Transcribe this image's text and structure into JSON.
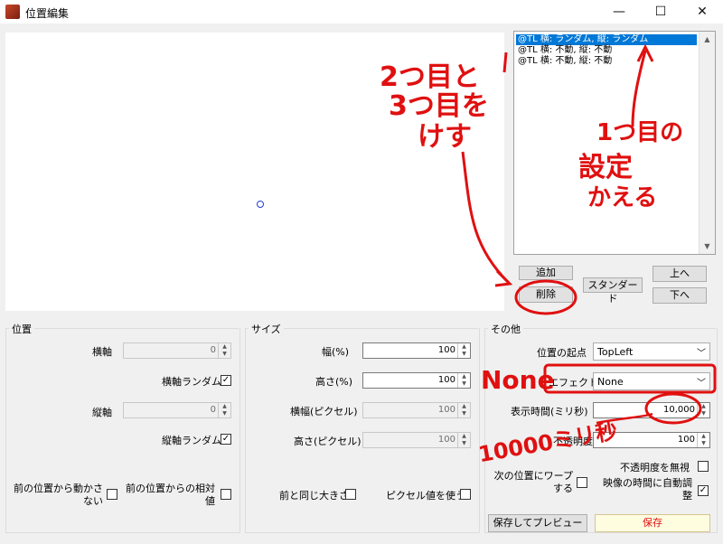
{
  "window": {
    "title": "位置編集",
    "minimize": "—",
    "maximize": "☐",
    "close": "✕"
  },
  "list": {
    "items": [
      "@TL 横: ランダム, 縦: ランダム",
      "@TL 横: 不動, 縦: 不動",
      "@TL 横: 不動, 縦: 不動"
    ],
    "selected_index": 0
  },
  "buttons": {
    "add": "追加",
    "delete": "削除",
    "standard": "スタンダード",
    "up": "上へ",
    "down": "下へ",
    "save_preview": "保存してプレビュー",
    "save": "保存"
  },
  "position": {
    "group_label": "位置",
    "x_label": "横軸",
    "x_value": "0",
    "x_random_label": "横軸ランダム",
    "x_random_checked": "✓",
    "y_label": "縦軸",
    "y_value": "0",
    "y_random_label": "縦軸ランダム",
    "y_random_checked": "✓",
    "move_from_prev_label": "前の位置から動かさない",
    "relative_label": "前の位置からの相対値"
  },
  "size": {
    "group_label": "サイズ",
    "width_pct_label": "幅(%)",
    "width_pct_value": "100",
    "height_pct_label": "高さ(%)",
    "height_pct_value": "100",
    "width_px_label": "横幅(ピクセル)",
    "width_px_value": "100",
    "height_px_label": "高さ(ピクセル)",
    "height_px_value": "100",
    "same_size_label": "前と同じ大きさ",
    "use_px_label": "ピクセル値を使う"
  },
  "other": {
    "group_label": "その他",
    "origin_label": "位置の起点",
    "origin_value": "TopLeft",
    "effect_label": "エフェクト",
    "effect_value": "None",
    "duration_label": "表示時間(ミリ秒)",
    "duration_value": "10,000",
    "opacity_label": "不透明度",
    "opacity_value": "100",
    "ignore_opacity_label": "不透明度を無視",
    "warp_label": "次の位置にワープする",
    "auto_adjust_label": "映像の時間に自動調整",
    "auto_adjust_checked": "✓"
  },
  "annotations": {
    "delete_note_1": "2つ目と",
    "delete_note_2": "3つ目を",
    "delete_note_3": "けす",
    "change_note_1": "1つ目の",
    "change_note_2": "設定",
    "change_note_3": "かえる",
    "none_note": "None",
    "ms_note": "10000ミリ秒"
  },
  "colors": {
    "annotation": "#e01010",
    "selection": "#0078d7",
    "save_button_bg": "#fffde0"
  }
}
